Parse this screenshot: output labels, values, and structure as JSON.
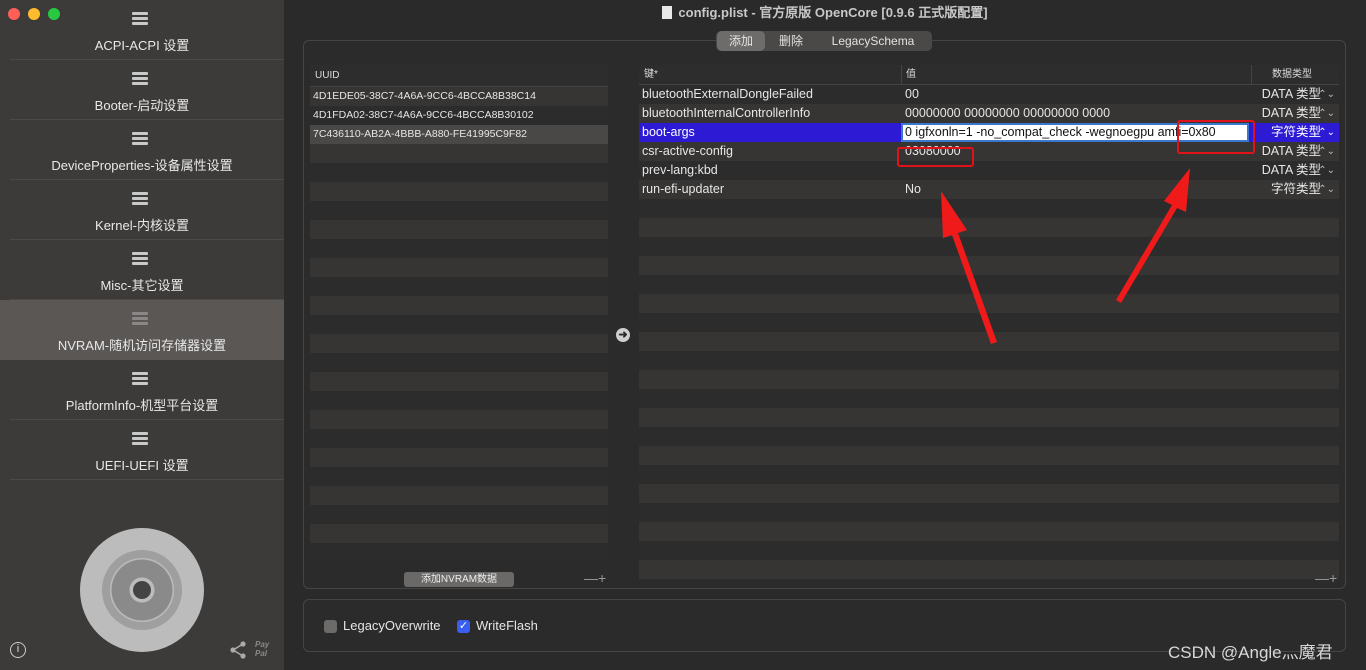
{
  "window": {
    "title": "config.plist - 官方原版 OpenCore [0.9.6 正式版配置]"
  },
  "traffic_lights": [
    "#fe5f57",
    "#febc2e",
    "#28c840"
  ],
  "sidebar": {
    "items": [
      {
        "label": "ACPI-ACPI 设置"
      },
      {
        "label": "Booter-启动设置"
      },
      {
        "label": "DeviceProperties-设备属性设置"
      },
      {
        "label": "Kernel-内核设置"
      },
      {
        "label": "Misc-其它设置"
      },
      {
        "label": "NVRAM-随机访问存储器设置",
        "active": true
      },
      {
        "label": "PlatformInfo-机型平台设置"
      },
      {
        "label": "UEFI-UEFI 设置"
      }
    ],
    "info_icon": "i",
    "paypal_text": "Pay\nPal"
  },
  "tabs": [
    {
      "label": "添加",
      "active": true
    },
    {
      "label": "删除"
    },
    {
      "label": "LegacySchema"
    }
  ],
  "uuid_table": {
    "header": "UUID",
    "rows": [
      "4D1EDE05-38C7-4A6A-9CC6-4BCCA8B38C14",
      "4D1FDA02-38C7-4A6A-9CC6-4BCCA8B30102",
      "7C436110-AB2A-4BBB-A880-FE41995C9F82"
    ],
    "selected_index": 2,
    "add_button": "添加NVRAM数据",
    "plus_minus": "—+"
  },
  "arrow_icon": "➜",
  "kv_table": {
    "headers": {
      "key": "键*",
      "value": "值",
      "type": "数据类型"
    },
    "rows": [
      {
        "key": "bluetoothExternalDongleFailed",
        "value": "00",
        "type": "DATA 类型"
      },
      {
        "key": "bluetoothInternalControllerInfo",
        "value": "00000000 00000000 00000000 0000",
        "type": "DATA 类型"
      },
      {
        "key": "boot-args",
        "value": "0 igfxonln=1 -no_compat_check -wegnoegpu amfi=0x80",
        "type": "字符类型",
        "selected": true
      },
      {
        "key": "csr-active-config",
        "value": "03080000",
        "type": "DATA 类型"
      },
      {
        "key": "prev-lang:kbd",
        "value": "",
        "type": "DATA 类型"
      },
      {
        "key": "run-efi-updater",
        "value": "No",
        "type": "字符类型"
      }
    ],
    "chevron": "⌃⌄",
    "plus_minus": "—+"
  },
  "options": {
    "legacy_overwrite": {
      "label": "LegacyOverwrite",
      "checked": false
    },
    "write_flash": {
      "label": "WriteFlash",
      "checked": true
    }
  },
  "watermark": "CSDN @Angle灬魔君",
  "colors": {
    "selection": "#2c1ad4",
    "annotation": "#e0131a",
    "check": "#3a5ef0"
  }
}
